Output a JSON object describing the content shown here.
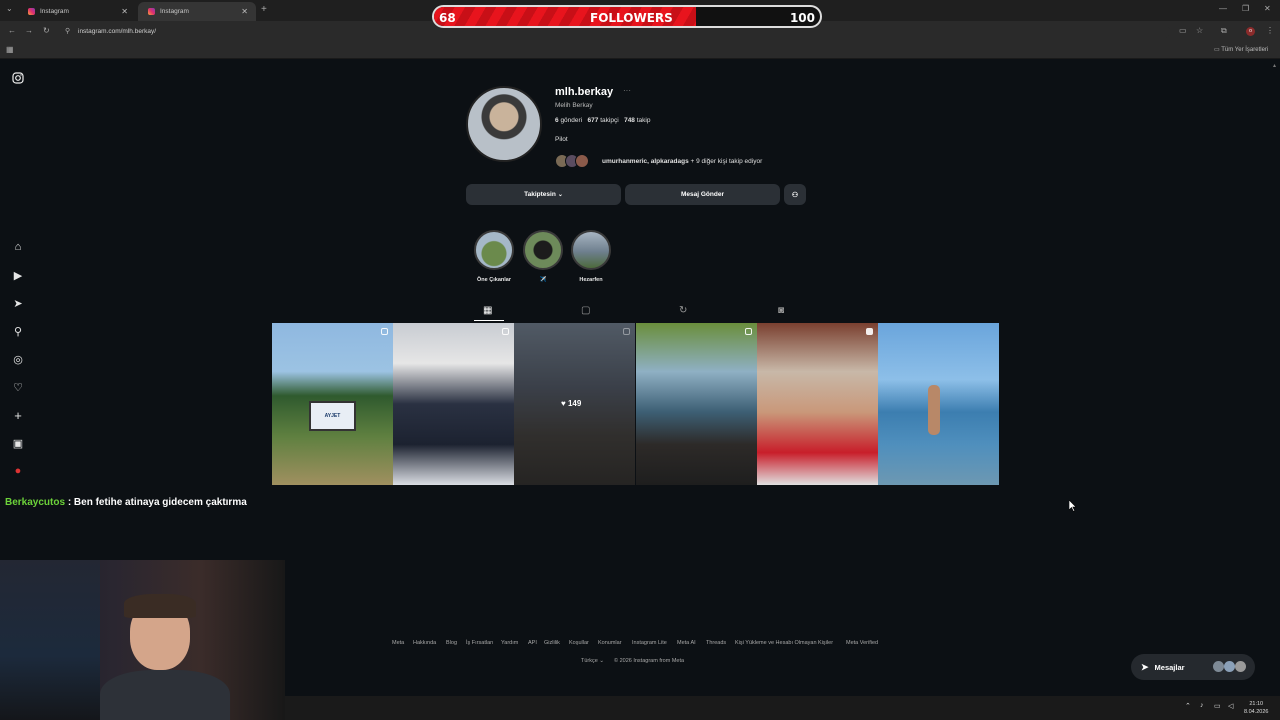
{
  "browser": {
    "tabs": [
      {
        "label": "Instagram"
      },
      {
        "label": "Instagram"
      }
    ],
    "url": "instagram.com/mlh.berkay/",
    "bookmarks_label": "Tüm Yer İşaretleri"
  },
  "overlay": {
    "followers_current": "68",
    "followers_label": "FOLLOWERS",
    "followers_goal": "100",
    "progress_fraction": 0.68
  },
  "profile": {
    "username": "mlh.berkay",
    "fullname": "Melih Berkay",
    "posts_count": "6",
    "posts_label": "gönderi",
    "followers_count": "677",
    "followers_label": "takipçi",
    "following_count": "748",
    "following_label": "takip",
    "bio": "Pilot",
    "followed_by_names": "umurhanmeric, alpkaradags",
    "followed_by_rest": "+ 9 diğer kişi takip ediyor",
    "following_button": "Takiptesin",
    "message_button": "Mesaj Gönder"
  },
  "highlights": [
    {
      "label": "Öne Çıkanlar"
    },
    {
      "label": "✈️"
    },
    {
      "label": "Hezarfen"
    }
  ],
  "posts": [
    {
      "likes": ""
    },
    {
      "likes": ""
    },
    {
      "likes": "149"
    },
    {
      "likes": ""
    },
    {
      "likes": ""
    },
    {
      "likes": ""
    }
  ],
  "chat": {
    "user": "Berkaycutos",
    "message": ": Ben fetihe atinaya gidecem çaktırma"
  },
  "footer": {
    "links": [
      "Meta",
      "Hakkında",
      "Blog",
      "İş Fırsatları",
      "Yardım",
      "API",
      "Gizlilik",
      "Koşullar",
      "Konumlar",
      "Instagram Lite",
      "Meta AI",
      "Threads",
      "Kişi Yükleme ve Hesabı Olmayan Kişiler",
      "Meta Verified"
    ],
    "language": "Türkçe",
    "copyright": "© 2026 Instagram from Meta"
  },
  "messages_button": "Mesajlar",
  "taskbar": {
    "time": "21:10",
    "date": "8.04.2026"
  }
}
